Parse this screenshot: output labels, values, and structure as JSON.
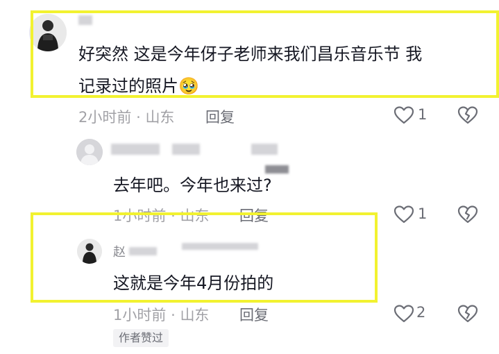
{
  "comments": [
    {
      "text_line1": "好突然  这是今年伢子老师来我们昌乐音乐节 我",
      "text_line2": "记录过的照片",
      "emoji": "🥹",
      "time": "2小时前",
      "separator": "·",
      "location": "山东",
      "reply_label": "回复",
      "likes": "1"
    },
    {
      "text": "去年吧。今年也来过?",
      "time": "1小时前",
      "separator": "·",
      "location": "山东",
      "reply_label": "回复",
      "likes": "1"
    },
    {
      "name_partial": "赵",
      "text": "这就是今年4月份拍的",
      "time": "1小时前",
      "separator": "·",
      "location": "山东",
      "reply_label": "回复",
      "likes": "2",
      "badge": "作者赞过"
    }
  ],
  "colors": {
    "highlight": "#f2f230",
    "meta": "#a1a1a6",
    "text": "#161823"
  },
  "icons": [
    "heart-icon",
    "dislike-icon",
    "avatar-icon"
  ]
}
